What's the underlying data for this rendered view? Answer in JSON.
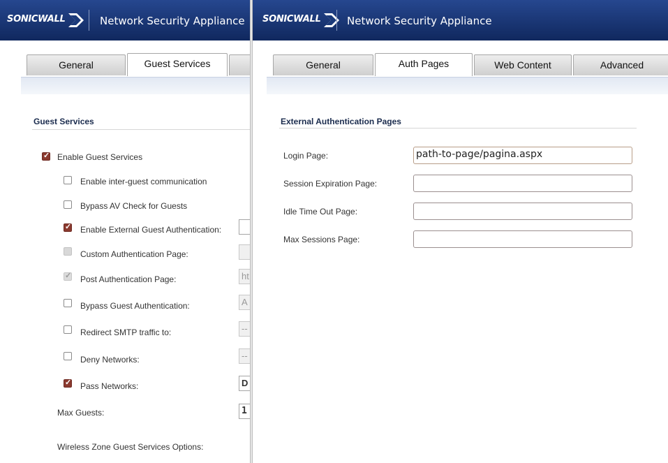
{
  "left": {
    "header": {
      "logo": "SONICWALL",
      "title": "Network Security Appliance"
    },
    "tabs": [
      {
        "label": "General",
        "active": false
      },
      {
        "label": "Guest Services",
        "active": true
      }
    ],
    "section_title": "Guest Services",
    "enable_guest_services": {
      "label": "Enable Guest Services",
      "checked": true
    },
    "options": [
      {
        "label": "Enable inter-guest communication",
        "state": "unchecked",
        "stub": ""
      },
      {
        "label": "Bypass AV Check for Guests",
        "state": "unchecked",
        "stub": ""
      },
      {
        "label": "Enable External Guest Authentication:",
        "state": "checked",
        "stub": ""
      },
      {
        "label": "Custom Authentication Page:",
        "state": "disabled",
        "stub": ""
      },
      {
        "label": "Post Authentication Page:",
        "state": "disabled-checked",
        "stub": "ht"
      },
      {
        "label": "Bypass Guest Authentication:",
        "state": "unchecked",
        "stub": "A"
      },
      {
        "label": "Redirect SMTP traffic to:",
        "state": "unchecked",
        "stub": "--"
      },
      {
        "label": "Deny Networks:",
        "state": "unchecked",
        "stub": "--"
      },
      {
        "label": "Pass Networks:",
        "state": "checked",
        "stub": "D"
      }
    ],
    "max_guests": {
      "label": "Max Guests:",
      "value": "1"
    },
    "wireless_options_label": "Wireless Zone Guest Services Options:"
  },
  "right": {
    "header": {
      "logo": "SONICWALL",
      "title": "Network Security Appliance"
    },
    "tabs": [
      {
        "label": "General",
        "active": false
      },
      {
        "label": "Auth Pages",
        "active": true
      },
      {
        "label": "Web Content",
        "active": false
      },
      {
        "label": "Advanced",
        "active": false
      }
    ],
    "section_title": "External Authentication Pages",
    "fields": [
      {
        "label": "Login Page:",
        "value": "path-to-page/pagina.aspx"
      },
      {
        "label": "Session Expiration Page:",
        "value": ""
      },
      {
        "label": "Idle Time Out Page:",
        "value": ""
      },
      {
        "label": "Max Sessions Page:",
        "value": ""
      }
    ]
  },
  "colors": {
    "header": "#1c3a7c",
    "checkbox_checked": "#8b3a2f",
    "section_title": "#1b2c4e"
  }
}
